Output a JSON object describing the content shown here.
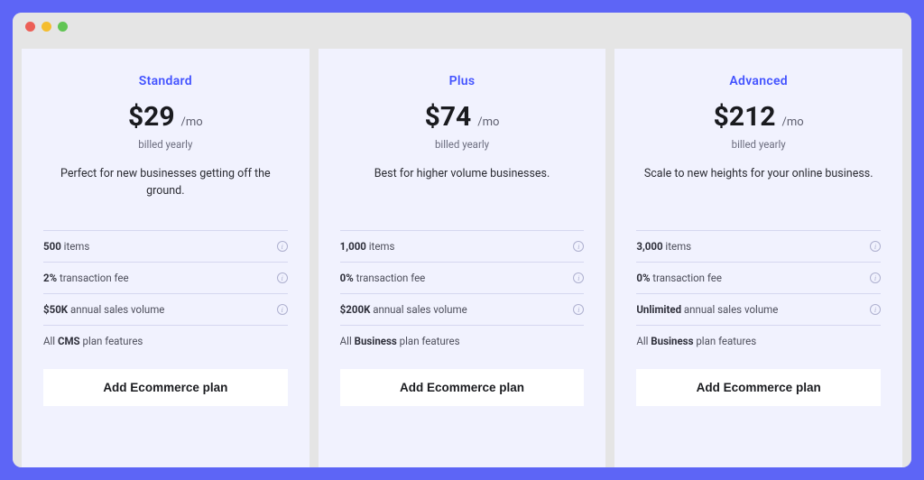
{
  "plans": [
    {
      "name": "Standard",
      "price": "$29",
      "per": "/mo",
      "billing": "billed yearly",
      "desc": "Perfect for new businesses getting off the ground.",
      "features": [
        {
          "bold": "500",
          "rest": " items",
          "info": true
        },
        {
          "bold": "2%",
          "rest": " transaction fee",
          "info": true
        },
        {
          "bold": "$50K",
          "rest": " annual sales volume",
          "info": true
        },
        {
          "bold_prefix": "All ",
          "bold": "CMS",
          "rest": " plan features",
          "info": false
        }
      ],
      "cta": "Add Ecommerce plan"
    },
    {
      "name": "Plus",
      "price": "$74",
      "per": "/mo",
      "billing": "billed yearly",
      "desc": "Best for higher volume businesses.",
      "features": [
        {
          "bold": "1,000",
          "rest": " items",
          "info": true
        },
        {
          "bold": "0%",
          "rest": " transaction fee",
          "info": true
        },
        {
          "bold": "$200K",
          "rest": " annual sales volume",
          "info": true
        },
        {
          "bold_prefix": "All ",
          "bold": "Business",
          "rest": " plan features",
          "info": false
        }
      ],
      "cta": "Add Ecommerce plan"
    },
    {
      "name": "Advanced",
      "price": "$212",
      "per": "/mo",
      "billing": "billed yearly",
      "desc": "Scale to new heights for your online business.",
      "features": [
        {
          "bold": "3,000",
          "rest": " items",
          "info": true
        },
        {
          "bold": "0%",
          "rest": " transaction fee",
          "info": true
        },
        {
          "bold": "Unlimited",
          "rest": " annual sales volume",
          "info": true
        },
        {
          "bold_prefix": "All ",
          "bold": "Business",
          "rest": " plan features",
          "info": false
        }
      ],
      "cta": "Add Ecommerce plan"
    }
  ]
}
